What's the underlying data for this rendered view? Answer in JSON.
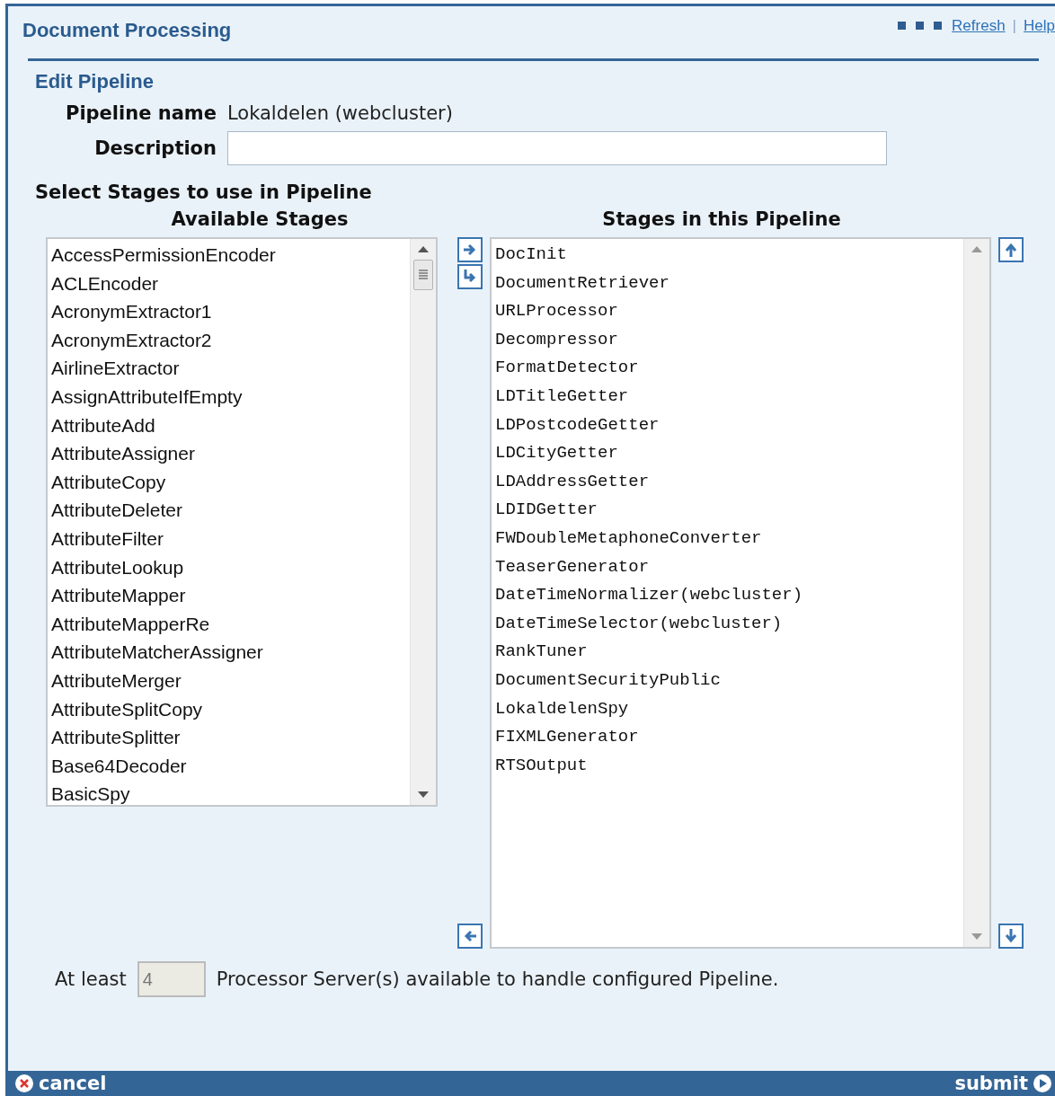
{
  "header": {
    "title": "Document Processing",
    "links": [
      {
        "label": "Refresh"
      },
      {
        "label": "Help"
      }
    ],
    "separator": "|"
  },
  "section_title": "Edit Pipeline",
  "form": {
    "name_label": "Pipeline name",
    "name_value": "Lokaldelen (webcluster)",
    "description_label": "Description"
  },
  "stages_title": "Select Stages to use in Pipeline",
  "available": {
    "heading": "Available Stages",
    "items": [
      "AccessPermissionEncoder",
      "ACLEncoder",
      "AcronymExtractor1",
      "AcronymExtractor2",
      "AirlineExtractor",
      "AssignAttributeIfEmpty",
      "AttributeAdd",
      "AttributeAssigner",
      "AttributeCopy",
      "AttributeDeleter",
      "AttributeFilter",
      "AttributeLookup",
      "AttributeMapper",
      "AttributeMapperRe",
      "AttributeMatcherAssigner",
      "AttributeMerger",
      "AttributeSplitCopy",
      "AttributeSplitter",
      "Base64Decoder",
      "BasicSpy"
    ]
  },
  "pipeline": {
    "heading": "Stages in this Pipeline",
    "items": [
      "DocInit",
      "DocumentRetriever",
      "URLProcessor",
      "Decompressor",
      "FormatDetector",
      "LDTitleGetter",
      "LDPostcodeGetter",
      "LDCityGetter",
      "LDAddressGetter",
      "LDIDGetter",
      "FWDoubleMetaphoneConverter",
      "TeaserGenerator",
      "DateTimeNormalizer(webcluster)",
      "DateTimeSelector(webcluster)",
      "RankTuner",
      "DocumentSecurityPublic",
      "LokaldelenSpy",
      "FIXMLGenerator",
      "RTSOutput"
    ]
  },
  "servers": {
    "prefix": "At least",
    "value": "4",
    "disabled": true,
    "suffix": "Processor Server(s) available to handle configured Pipeline."
  },
  "footer": {
    "cancel": "cancel",
    "submit": "submit"
  }
}
